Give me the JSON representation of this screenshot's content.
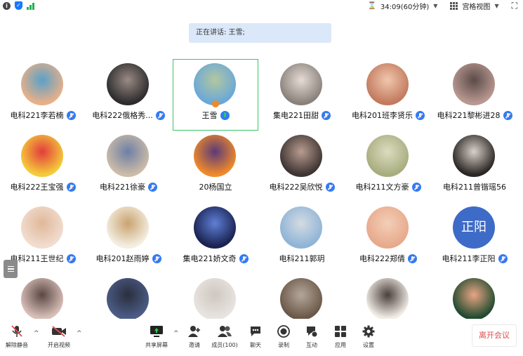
{
  "topbar": {
    "timer": "34:09(60分钟)",
    "view_mode": "宫格视图"
  },
  "speaking": {
    "text": "正在讲话: 王雪;"
  },
  "participants": [
    {
      "name": "电科221李若楠",
      "mic": "muted",
      "avatar_color": "#e8b089",
      "avatar_accent": "#5aa0c8"
    },
    {
      "name": "电科222俄格秀...",
      "mic": "muted",
      "avatar_color": "#2c2c2c",
      "avatar_accent": "#9a8a84"
    },
    {
      "name": "王雪",
      "mic": "active",
      "avatar_color": "#6aa8d8",
      "avatar_accent": "#b3c7a0"
    },
    {
      "name": "集电221田甜",
      "mic": "muted",
      "avatar_color": "#8a817b",
      "avatar_accent": "#e6dcd5"
    },
    {
      "name": "电科201班李贤乐",
      "mic": "muted",
      "avatar_color": "#c27a5e",
      "avatar_accent": "#f0c7ad"
    },
    {
      "name": "电科221黎彬进28",
      "mic": "muted",
      "avatar_color": "#b99891",
      "avatar_accent": "#5b4b48"
    },
    {
      "name": "电科222王宝强",
      "mic": "muted",
      "avatar_color": "#f5cc3a",
      "avatar_accent": "#e23c3c"
    },
    {
      "name": "电科221徐豪",
      "mic": "muted",
      "avatar_color": "#ccbca8",
      "avatar_accent": "#6d7fa5"
    },
    {
      "name": "20杨国立",
      "mic": "none",
      "avatar_color": "#f08a2a",
      "avatar_accent": "#5b3a78"
    },
    {
      "name": "电科222吴欣悦",
      "mic": "muted",
      "avatar_color": "#3e3432",
      "avatar_accent": "#b89c90"
    },
    {
      "name": "电科211文方豪",
      "mic": "muted",
      "avatar_color": "#a8ad7e",
      "avatar_accent": "#dcdcc0"
    },
    {
      "name": "电科211曾锴瑶56",
      "mic": "none",
      "avatar_color": "#2a2624",
      "avatar_accent": "#d9d0c8"
    },
    {
      "name": "电科211王世纪",
      "mic": "muted",
      "avatar_color": "#f1ddd0",
      "avatar_accent": "#e0b89a"
    },
    {
      "name": "电科201赵雨婷",
      "mic": "muted",
      "avatar_color": "#f4eee1",
      "avatar_accent": "#c9a36f"
    },
    {
      "name": "集电221娇文奇",
      "mic": "muted",
      "avatar_color": "#1a2250",
      "avatar_accent": "#5f7fd6"
    },
    {
      "name": "电科211郭玥",
      "mic": "none",
      "avatar_color": "#8fb4d6",
      "avatar_accent": "#d4dbe3"
    },
    {
      "name": "电科222郑倩",
      "mic": "muted",
      "avatar_color": "#e7a98b",
      "avatar_accent": "#f3cfb8"
    },
    {
      "name": "电科211李正阳",
      "mic": "muted",
      "avatar_color": "#3d6bc7",
      "avatar_accent": "#3d6bc7",
      "initials": "正阳"
    },
    {
      "name": "",
      "mic": "none",
      "avatar_color": "#d9bfb8",
      "avatar_accent": "#5a4845"
    },
    {
      "name": "",
      "mic": "none",
      "avatar_color": "#4b5c86",
      "avatar_accent": "#2b2f3e"
    },
    {
      "name": "",
      "mic": "none",
      "avatar_color": "#e8e4e0",
      "avatar_accent": "#cfc7c0"
    },
    {
      "name": "",
      "mic": "none",
      "avatar_color": "#6b5848",
      "avatar_accent": "#b4a79a"
    },
    {
      "name": "",
      "mic": "none",
      "avatar_color": "#f2ece6",
      "avatar_accent": "#4a3f3a"
    },
    {
      "name": "",
      "mic": "none",
      "avatar_color": "#1f4a2e",
      "avatar_accent": "#e9a585"
    }
  ],
  "toolbar": {
    "unmute": "解除静音",
    "start_video": "开启视频",
    "share_screen": "共享屏幕",
    "invite": "邀请",
    "members": "成员(100)",
    "chat": "聊天",
    "record": "录制",
    "interact": "互动",
    "apps": "应用",
    "settings": "设置",
    "leave": "离开会议"
  },
  "colors": {
    "accent_blue": "#2f7cf6",
    "active_speaker_border": "#3cc36a",
    "leave_red": "#e34d4d",
    "banner_bg": "#dbe8f9"
  }
}
